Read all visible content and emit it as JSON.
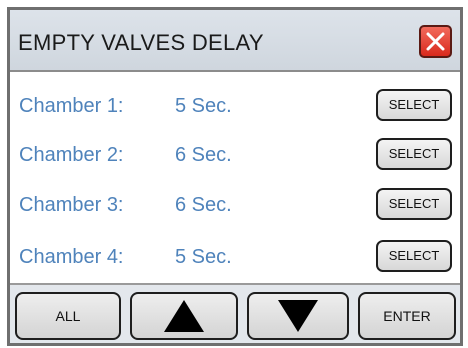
{
  "header": {
    "title": "EMPTY VALVES DELAY",
    "close_icon": "close-x-icon",
    "close_color": "#d9291c"
  },
  "chambers": [
    {
      "label": "Chamber 1:",
      "value": "5 Sec.",
      "select_label": "SELECT"
    },
    {
      "label": "Chamber 2:",
      "value": "6 Sec.",
      "select_label": "SELECT"
    },
    {
      "label": "Chamber 3:",
      "value": "6 Sec.",
      "select_label": "SELECT"
    },
    {
      "label": "Chamber 4:",
      "value": "5 Sec.",
      "select_label": "SELECT"
    }
  ],
  "footer": {
    "all_label": "ALL",
    "up_icon": "arrow-up-icon",
    "down_icon": "arrow-down-icon",
    "enter_label": "ENTER"
  },
  "colors": {
    "accent_text": "#4f83bb",
    "header_bg": "#d6dce3"
  }
}
